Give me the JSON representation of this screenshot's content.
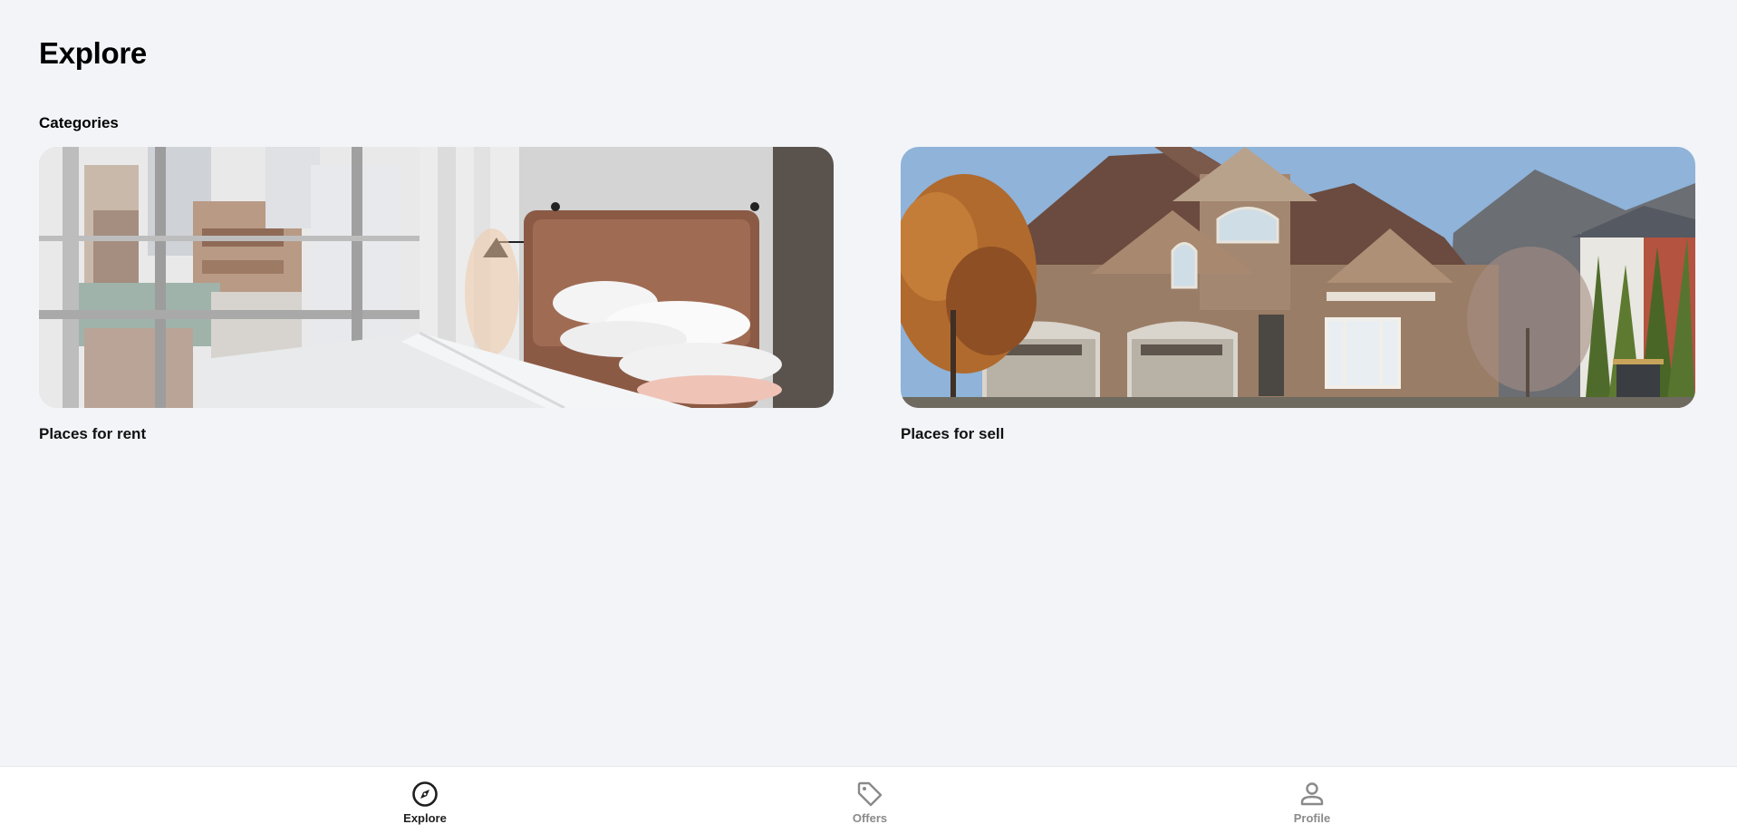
{
  "page": {
    "title": "Explore"
  },
  "categories": {
    "heading": "Categories",
    "items": [
      {
        "label": "Places for rent",
        "image": "bedroom-photo"
      },
      {
        "label": "Places for sell",
        "image": "house-photo"
      }
    ]
  },
  "nav": {
    "items": [
      {
        "label": "Explore",
        "icon": "compass-icon",
        "active": true
      },
      {
        "label": "Offers",
        "icon": "tag-icon",
        "active": false
      },
      {
        "label": "Profile",
        "icon": "person-icon",
        "active": false
      }
    ]
  },
  "colors": {
    "background": "#f2f4f8",
    "nav_active": "#1f1f1f",
    "nav_inactive": "#8a8a8a"
  }
}
